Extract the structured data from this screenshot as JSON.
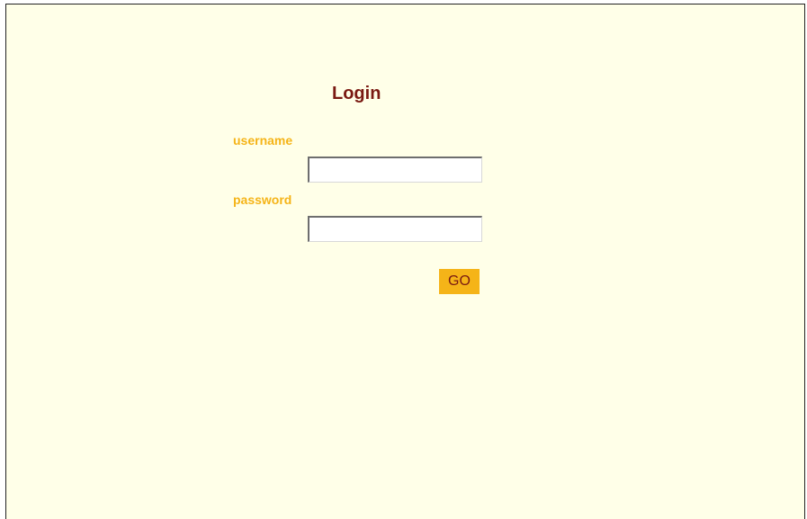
{
  "login": {
    "title": "Login",
    "username_label": "username",
    "username_value": "",
    "password_label": "password",
    "password_value": "",
    "submit_label": "GO"
  },
  "colors": {
    "page_background": "#ffffe8",
    "title_color": "#7a1a12",
    "label_color": "#f5b418",
    "button_background": "#f5b418",
    "button_text_color": "#7a1a12"
  }
}
